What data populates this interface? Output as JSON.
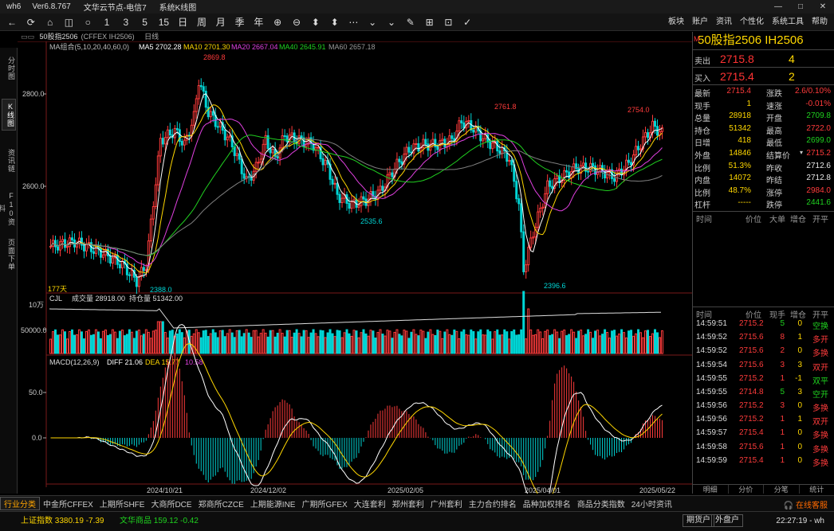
{
  "window": {
    "app": "wh6",
    "version": "Ver6.8.767",
    "node": "文华云节点-电信7",
    "mode": "系统K线图"
  },
  "toolbar": {
    "icons": [
      "←",
      "⟳",
      "⌂",
      "◫",
      "○",
      "1",
      "3",
      "5",
      "15",
      "日",
      "周",
      "月",
      "季",
      "年",
      "⊕",
      "⊖",
      "⬍",
      "⬍",
      "⋯",
      "⌄",
      "⌄",
      "✎",
      "⊞",
      "⊡",
      "✓"
    ],
    "menu": [
      "板块",
      "账户",
      "资讯",
      "个性化",
      "系统工具",
      "帮助"
    ]
  },
  "left_tabs": [
    "分时图",
    "K线图",
    "资讯链",
    "F10资料",
    "页面下单"
  ],
  "chart_header": {
    "contract": "50股指2506",
    "code": "(CFFEX IH2506)",
    "period": "日线"
  },
  "ma_legend": {
    "label": "MA组合(5,10,20,40,60,0)",
    "ma5": "MA5 2702.28",
    "ma10": "MA10 2701.30",
    "ma20": "MA20 2667.04",
    "ma40": "MA40 2645.91",
    "ma60": "MA60 2657.18"
  },
  "price_axis": [
    "2800.0",
    "2600.0"
  ],
  "annotations": {
    "high1": "2869.8",
    "low1": "2388.0",
    "low2": "2535.6",
    "high2": "2761.8",
    "low3": "2396.6",
    "high3": "2754.0",
    "days": "177天"
  },
  "volume": {
    "label": "CJL",
    "vol": "成交量 28918.00",
    "oi": "持仓量 51342.00",
    "axis_top": "10万",
    "axis_mid": "50000.0"
  },
  "macd": {
    "label": "MACD(12,26,9)",
    "diff": "DIFF 21.06",
    "dea": "DEA 15.77",
    "macd": "10.58",
    "axis": [
      "50.0",
      "0.0"
    ]
  },
  "date_axis": [
    "2024/10/21",
    "2024/12/02",
    "2025/02/05",
    "2025/04/01",
    "2025/05/22"
  ],
  "colors": {
    "up": "#ff3b3b",
    "down": "#00d5d5",
    "ma5": "#ffffff",
    "ma10": "#ffd700",
    "ma20": "#e040e0",
    "ma40": "#20d020",
    "ma60": "#808080"
  },
  "quote": {
    "title": "50股指2506  IH2506",
    "title_mark": "M",
    "sell": {
      "label": "卖出",
      "price": "2715.8",
      "vol": "4"
    },
    "buy": {
      "label": "买入",
      "price": "2715.4",
      "vol": "2"
    },
    "rows": [
      [
        "最新",
        "2715.4",
        "涨跌",
        "2.6/0.10%"
      ],
      [
        "现手",
        "1",
        "速涨",
        "-0.01%"
      ],
      [
        "总量",
        "28918",
        "开盘",
        "2709.8"
      ],
      [
        "持仓",
        "51342",
        "最高",
        "2722.0"
      ],
      [
        "日增",
        "418",
        "最低",
        "2699.0"
      ],
      [
        "外盘",
        "14846",
        "结算价",
        "2715.2"
      ],
      [
        "比例",
        "51.3%",
        "昨收",
        "2712.6"
      ],
      [
        "内盘",
        "14072",
        "昨结",
        "2712.8"
      ],
      [
        "比例",
        "48.7%",
        "涨停",
        "2984.0"
      ],
      [
        "杠杆",
        "-----",
        "跌停",
        "2441.6"
      ]
    ]
  },
  "tick_head": [
    "时间",
    "价位",
    "大单",
    "增仓",
    "开平"
  ],
  "trade_head": [
    "时间",
    "价位",
    "现手",
    "增仓",
    "开平"
  ],
  "trades": [
    [
      "14:59:51",
      "2715.2",
      "5",
      "0",
      "空换"
    ],
    [
      "14:59:52",
      "2715.6",
      "8",
      "1",
      "多开"
    ],
    [
      "14:59:52",
      "2715.6",
      "2",
      "0",
      "多换"
    ],
    [
      "14:59:54",
      "2715.6",
      "3",
      "3",
      "双开"
    ],
    [
      "14:59:55",
      "2715.2",
      "1",
      "-1",
      "双平"
    ],
    [
      "14:59:55",
      "2714.8",
      "5",
      "3",
      "空开"
    ],
    [
      "14:59:56",
      "2715.2",
      "3",
      "0",
      "多换"
    ],
    [
      "14:59:56",
      "2715.2",
      "1",
      "1",
      "双开"
    ],
    [
      "14:59:57",
      "2715.4",
      "1",
      "0",
      "多换"
    ],
    [
      "14:59:58",
      "2715.6",
      "1",
      "0",
      "多换"
    ],
    [
      "14:59:59",
      "2715.4",
      "1",
      "0",
      "多换"
    ]
  ],
  "right_tabs": [
    "明细",
    "分价",
    "分笔",
    "统计"
  ],
  "bottom_tabs": [
    "行业分类",
    "中金所CFFEX",
    "上期所SHFE",
    "大商所DCE",
    "郑商所CZCE",
    "上期能源INE",
    "广期所GFEX",
    "大连套利",
    "郑州套利",
    "广州套利",
    "主力合约排名",
    "品种加权排名",
    "商品分类指数",
    "24小时资讯"
  ],
  "bottom_right": "在线客服",
  "status": {
    "idx1": "上证指数  3380.19  -7.39",
    "idx2": "文华商品  159.12  -0.42",
    "btn1": "期货户",
    "btn2": "外盘户",
    "clock": "22:27:19 - wh"
  }
}
